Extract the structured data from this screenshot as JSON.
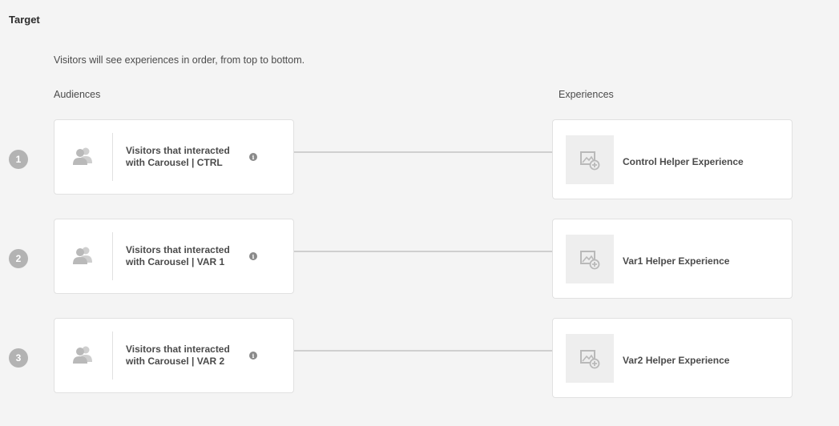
{
  "section": {
    "title": "Target"
  },
  "intro": "Visitors will see experiences in order, from top to bottom.",
  "columns": {
    "audiences": "Audiences",
    "experiences": "Experiences"
  },
  "rows": [
    {
      "number": "1",
      "audience_line1": "Visitors that interacted",
      "audience_line2": "with Carousel | CTRL",
      "experience": "Control Helper Experience"
    },
    {
      "number": "2",
      "audience_line1": "Visitors that interacted",
      "audience_line2": "with Carousel | VAR 1",
      "experience": "Var1 Helper Experience"
    },
    {
      "number": "3",
      "audience_line1": "Visitors that interacted",
      "audience_line2": "with Carousel | VAR 2",
      "experience": "Var2 Helper Experience"
    }
  ],
  "icons": {
    "audience": "users-icon",
    "info": "info-icon",
    "experience": "image-add-icon"
  },
  "colors": {
    "background": "#f4f4f4",
    "card": "#ffffff",
    "border": "#e1e1e1",
    "step_badge": "#b3b3b3",
    "connector": "#cfcfcf",
    "icon": "#b9b9b9"
  }
}
